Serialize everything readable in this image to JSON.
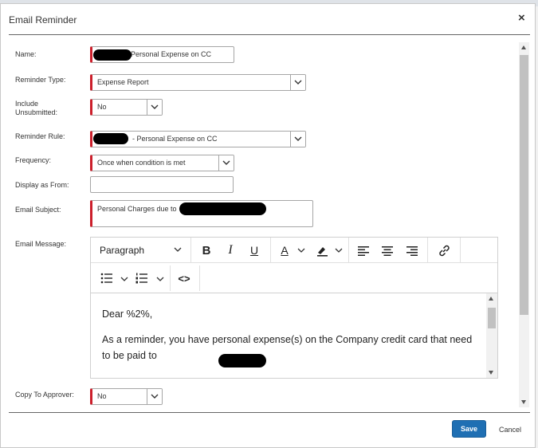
{
  "dialog": {
    "title": "Email Reminder",
    "close_label": "×"
  },
  "form": {
    "name_label": "Name:",
    "name_value": "Personal Expense on CC",
    "reminder_type_label": "Reminder Type:",
    "reminder_type_value": "Expense Report",
    "include_unsubmitted_label_1": "Include",
    "include_unsubmitted_label_2": "Unsubmitted:",
    "include_unsubmitted_value": "No",
    "reminder_rule_label": "Reminder Rule:",
    "reminder_rule_value": "- Personal Expense on CC",
    "frequency_label": "Frequency:",
    "frequency_value": "Once when condition is met",
    "display_from_label": "Display as From:",
    "display_from_value": "",
    "email_subject_label": "Email Subject:",
    "email_subject_value": "Personal Charges due to",
    "email_message_label": "Email Message:",
    "copy_approver_label": "Copy To Approver:",
    "copy_approver_value": "No"
  },
  "editor": {
    "format_value": "Paragraph",
    "bold": "B",
    "italic": "I",
    "underline": "U",
    "font_color": "A",
    "source": "<>",
    "paragraph_1": "Dear %2%,",
    "paragraph_2": "As a reminder, you have personal expense(s) on the Company credit card that need to be paid to"
  },
  "footer": {
    "save_label": "Save",
    "cancel_label": "Cancel"
  },
  "colors": {
    "required_marker": "#cc1f2b",
    "primary_button": "#1f6fb3"
  }
}
